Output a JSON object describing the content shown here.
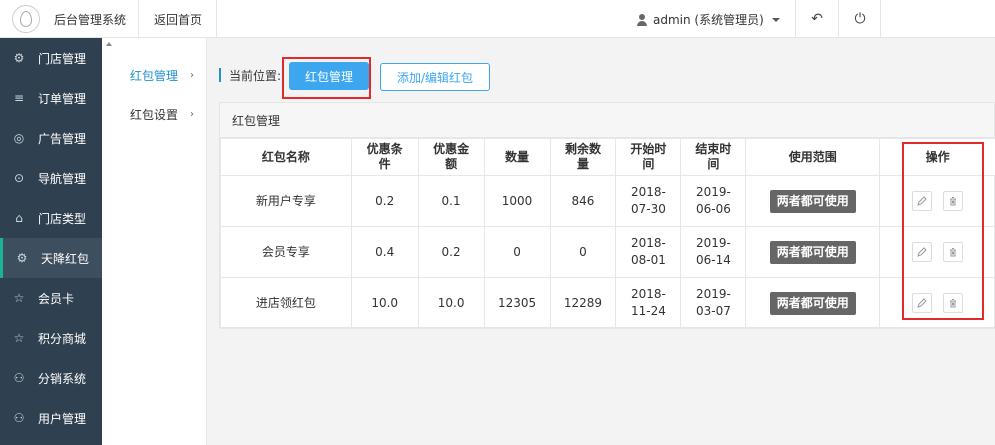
{
  "header": {
    "app_title": "后台管理系统",
    "home_link": "返回首页",
    "user": "admin (系统管理员)",
    "back_icon": "↶",
    "power_icon": "⏻"
  },
  "sidebar": {
    "items": [
      {
        "label": "门店管理",
        "icon": "⚙"
      },
      {
        "label": "订单管理",
        "icon": "≡"
      },
      {
        "label": "广告管理",
        "icon": "◎"
      },
      {
        "label": "导航管理",
        "icon": "⊙"
      },
      {
        "label": "门店类型",
        "icon": "⌂"
      },
      {
        "label": "天降红包",
        "icon": "⚙"
      },
      {
        "label": "会员卡",
        "icon": "☆"
      },
      {
        "label": "积分商城",
        "icon": "☆"
      },
      {
        "label": "分销系统",
        "icon": "⚇"
      },
      {
        "label": "用户管理",
        "icon": "⚇"
      }
    ]
  },
  "subnav": {
    "items": [
      {
        "label": "红包管理"
      },
      {
        "label": "红包设置"
      }
    ],
    "chevron": "›"
  },
  "toolbar": {
    "location_label": "当前位置:",
    "current_button": "红包管理",
    "add_button": "添加/编辑红包"
  },
  "panel": {
    "title": "红包管理",
    "columns": [
      "红包名称",
      "优惠条件",
      "优惠金额",
      "数量",
      "剩余数量",
      "开始时间",
      "结束时间",
      "使用范围",
      "操作"
    ],
    "rows": [
      {
        "name": "新用户专享",
        "condition": "0.2",
        "amount": "0.1",
        "quantity": "1000",
        "remaining": "846",
        "start": "2018-07-30",
        "end": "2019-06-06",
        "scope": "两者都可使用"
      },
      {
        "name": "会员专享",
        "condition": "0.4",
        "amount": "0.2",
        "quantity": "0",
        "remaining": "0",
        "start": "2018-08-01",
        "end": "2019-06-14",
        "scope": "两者都可使用"
      },
      {
        "name": "进店领红包",
        "condition": "10.0",
        "amount": "10.0",
        "quantity": "12305",
        "remaining": "12289",
        "start": "2018-11-24",
        "end": "2019-03-07",
        "scope": "两者都可使用"
      }
    ]
  },
  "colors": {
    "sidebar_bg": "#2f4050",
    "primary": "#3ca7ef",
    "highlight": "#e12a2a",
    "badge_bg": "#666666"
  }
}
